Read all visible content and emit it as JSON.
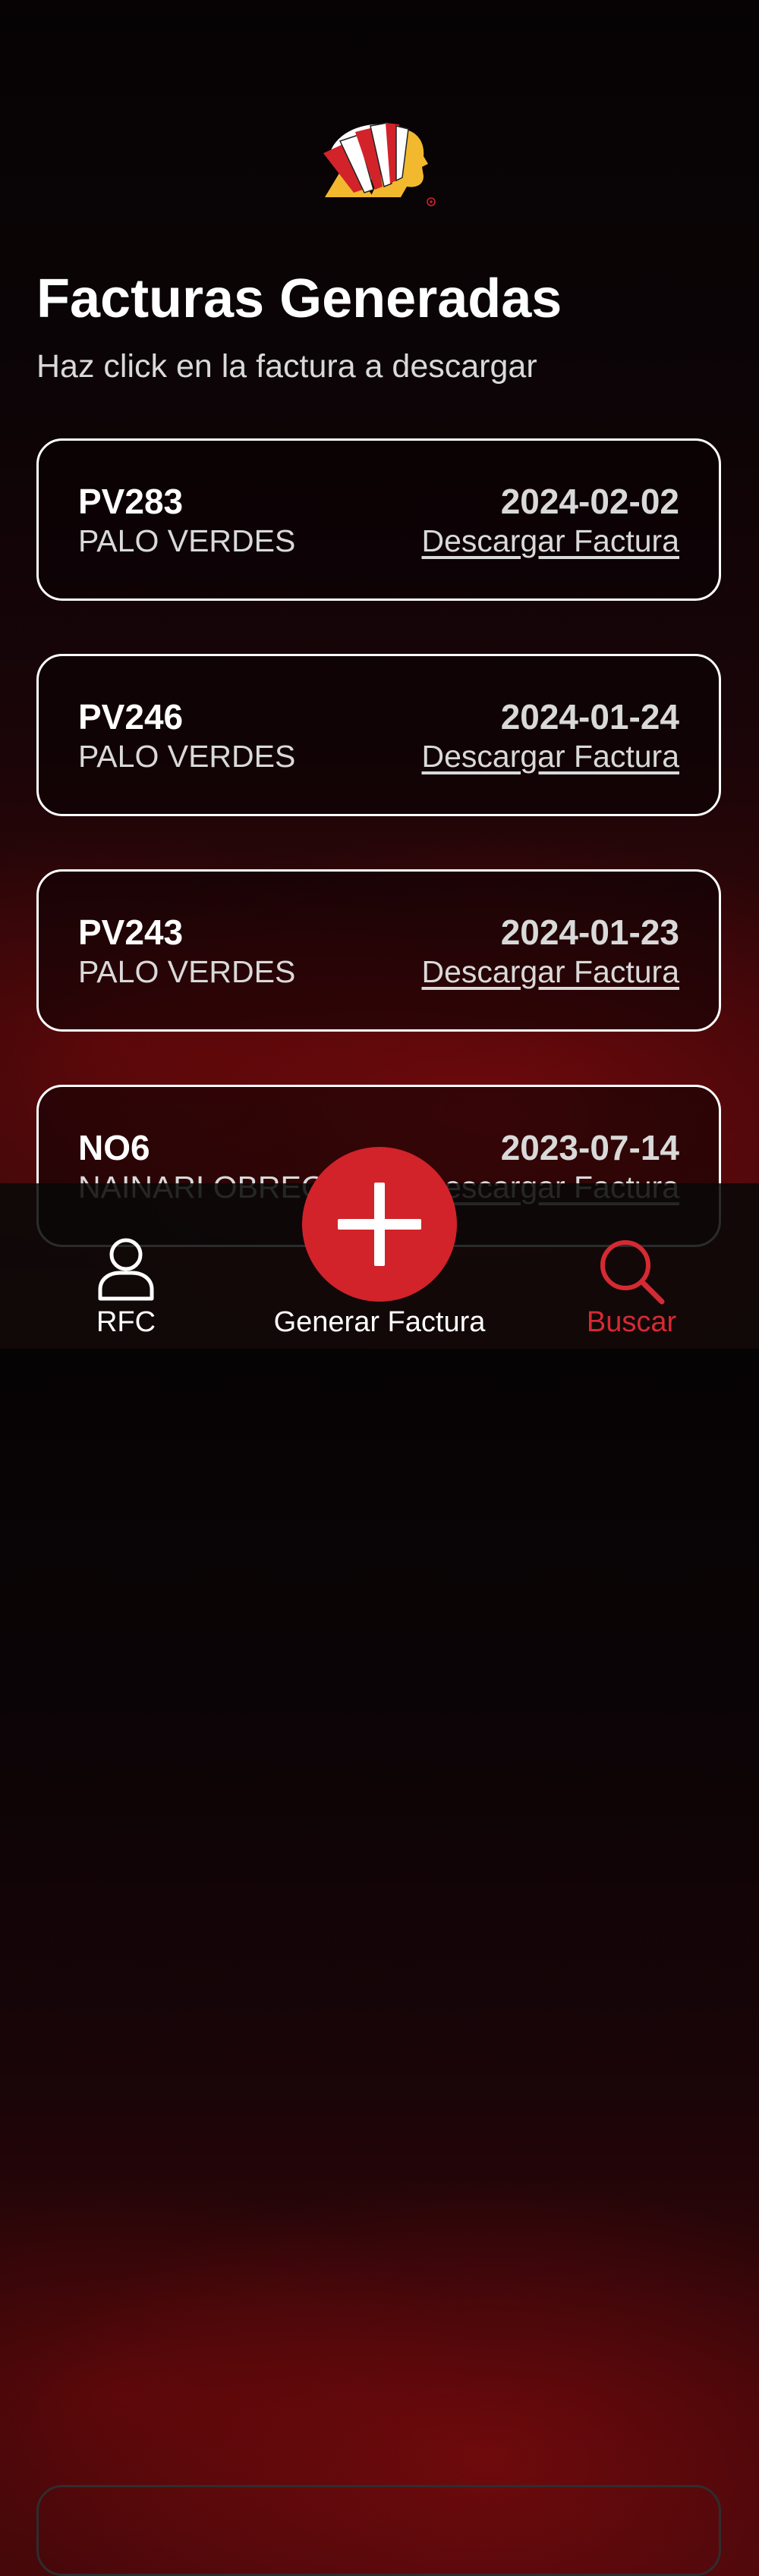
{
  "header": {
    "title": "Facturas Generadas",
    "subtitle": "Haz click en la factura a descargar"
  },
  "invoices": [
    {
      "code": "PV283",
      "location": "PALO VERDES",
      "date": "2024-02-02",
      "action": "Descargar Factura"
    },
    {
      "code": "PV246",
      "location": "PALO VERDES",
      "date": "2024-01-24",
      "action": "Descargar Factura"
    },
    {
      "code": "PV243",
      "location": "PALO VERDES",
      "date": "2024-01-23",
      "action": "Descargar Factura"
    },
    {
      "code": "NO6",
      "location": "NAINARI OBREG",
      "date": "2023-07-14",
      "action": "Descargar Factura"
    }
  ],
  "tab_bar": {
    "items": [
      {
        "label": "RFC",
        "icon": "person-icon"
      },
      {
        "label": "Generar Factura",
        "icon": "plus-icon"
      },
      {
        "label": "Buscar",
        "icon": "search-icon",
        "active": true
      }
    ]
  },
  "colors": {
    "accent": "#d2232a",
    "active_tab": "#d52a33",
    "card_border": "#ffffff"
  }
}
